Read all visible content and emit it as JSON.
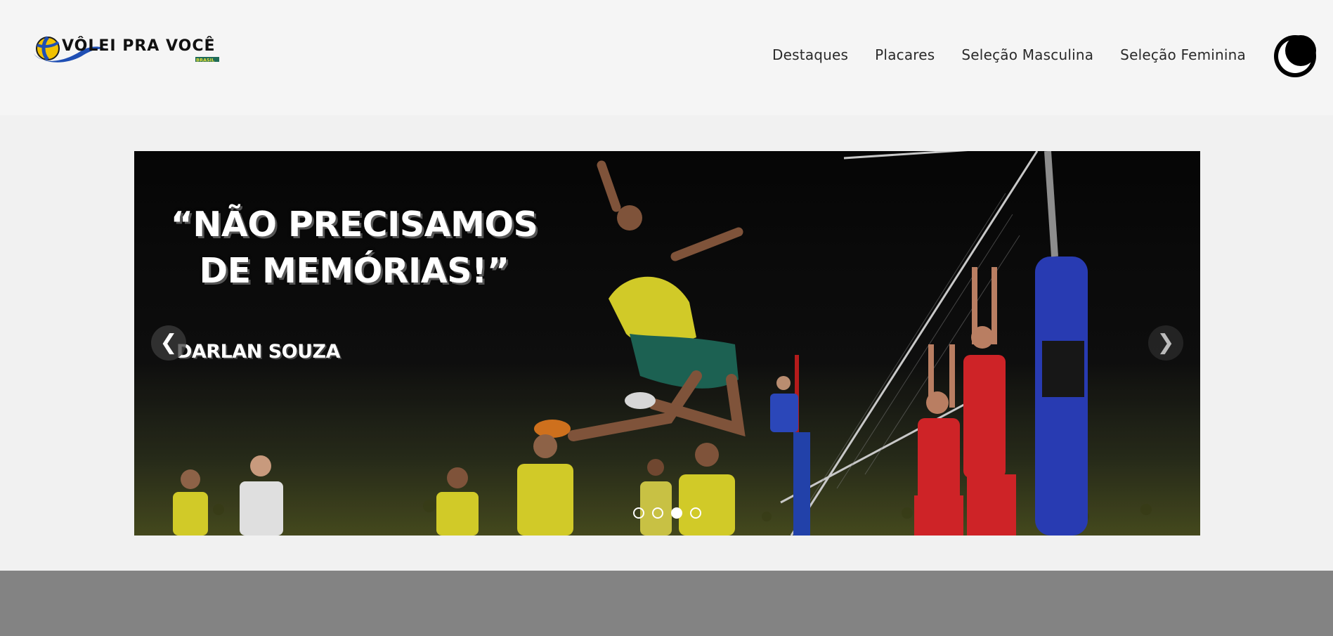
{
  "brand": {
    "logo_text": "VÔLEI PRA VOCÊ",
    "logo_subtext": "BRASIL",
    "logo_icon": "volleyball-icon"
  },
  "nav": {
    "items": [
      {
        "label": "Destaques"
      },
      {
        "label": "Placares"
      },
      {
        "label": "Seleção Masculina"
      },
      {
        "label": "Seleção Feminina"
      }
    ],
    "theme_toggle_icon": "moon-icon"
  },
  "carousel": {
    "quote": "“NÃO PRECISAMOS DE MEMÓRIAS!”",
    "author": "DARLAN SOUZA",
    "prev_icon": "chevron-left-icon",
    "prev_label": "❮",
    "next_icon": "chevron-right-icon",
    "next_label": "❯",
    "slide_count": 4,
    "active_index": 2
  },
  "colors": {
    "brand_blue": "#1f4fb4",
    "brazil_yellow": "#e8e23a",
    "brazil_green": "#1e6b57",
    "opponent_red": "#e0262b",
    "footer": "#838383"
  }
}
